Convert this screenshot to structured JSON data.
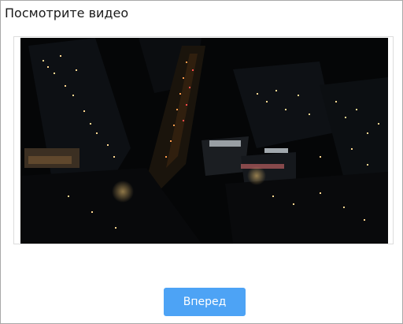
{
  "page": {
    "title": "Посмотрите видео"
  },
  "video": {
    "description_icon": "city-night-aerial-video"
  },
  "actions": {
    "next_label": "Вперед"
  },
  "colors": {
    "button_bg": "#4da3f5",
    "button_text": "#ffffff",
    "video_bg": "#050607"
  }
}
